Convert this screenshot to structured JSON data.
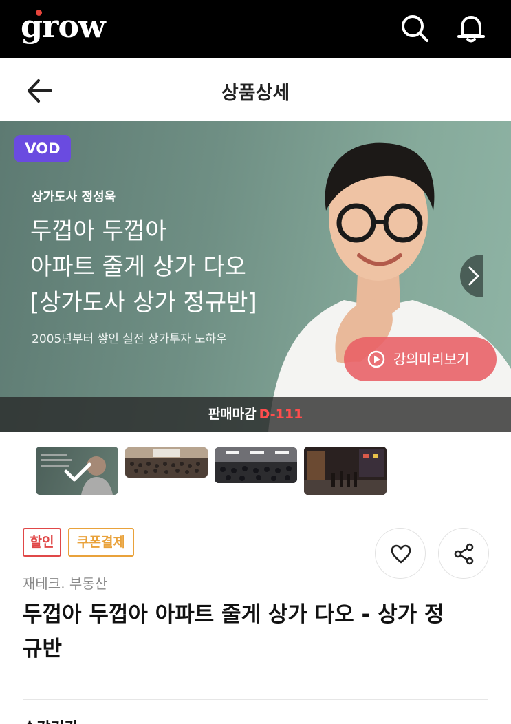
{
  "header": {
    "logo_text": "grow",
    "logo_dot_color": "#e8453c",
    "icons": [
      "search-icon",
      "bell-icon"
    ]
  },
  "navbar": {
    "title": "상품상세",
    "back_icon": "arrow-left-icon"
  },
  "banner": {
    "badge": "VOD",
    "instructor": "상가도사 정성욱",
    "headline_lines": [
      "두껍아 두껍아",
      "아파트 줄게 상가 다오",
      "[상가도사 상가 정규반]"
    ],
    "subtext": "2005년부터 쌓인 실전 상가투자 노하우",
    "preview_button": "강의미리보기",
    "deadline_label": "판매마감",
    "deadline_dday": "D-111",
    "badge_color": "#6a4be0",
    "dday_color": "#ff4d4d"
  },
  "thumbnails": [
    {
      "name": "thumbnail-banner",
      "selected": true
    },
    {
      "name": "thumbnail-seminar-1",
      "selected": false
    },
    {
      "name": "thumbnail-seminar-2",
      "selected": false
    },
    {
      "name": "thumbnail-night-street",
      "selected": false
    }
  ],
  "tags": [
    "할인",
    "쿠폰결제"
  ],
  "tag_colors": {
    "sale": "#e04848",
    "coupon": "#e9a23b"
  },
  "actions": [
    "heart-icon",
    "share-icon"
  ],
  "product": {
    "category": "재테크. 부동산",
    "title": "두껍아 두껍아 아파트 줄게 상가 다오 - 상가 정규반"
  },
  "next_section": "수강기간"
}
